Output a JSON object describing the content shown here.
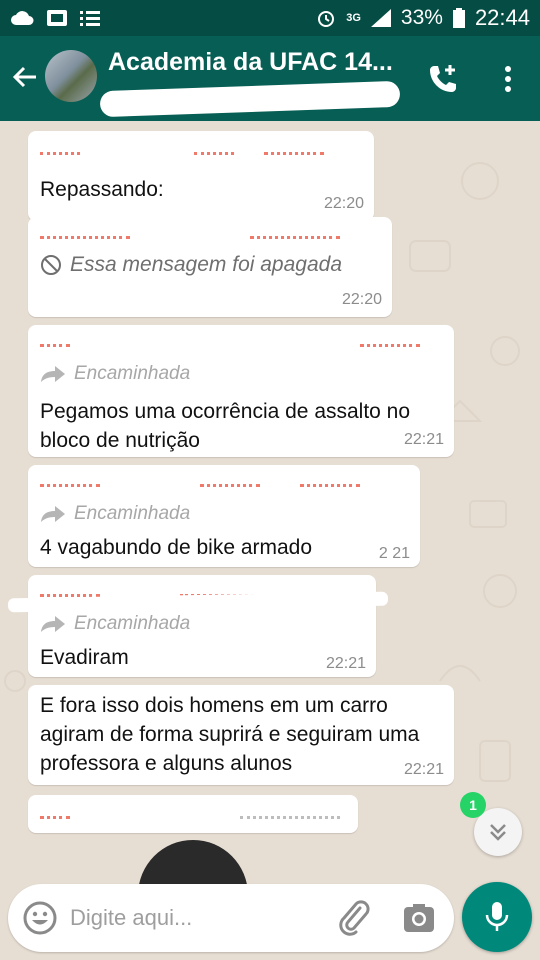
{
  "status_bar": {
    "network": "3G",
    "battery_percent": "33%",
    "time": "22:44"
  },
  "header": {
    "title": "Academia da UFAC 14..."
  },
  "messages": [
    {
      "text": "Repassando:",
      "time": "22:20"
    },
    {
      "deleted_text": "Essa mensagem foi apagada",
      "time": "22:20"
    },
    {
      "forwarded_label": "Encaminhada",
      "text": "Pegamos uma ocorrência de assalto no bloco de nutrição",
      "time": "22:21"
    },
    {
      "forwarded_label": "Encaminhada",
      "text": "4 vagabundo de bike armado",
      "time": "2 21"
    },
    {
      "forwarded_label": "Encaminhada",
      "text": "Evadiram",
      "time": "22:21"
    },
    {
      "text": "E fora isso dois homens em um carro agiram de forma suprirá e seguiram uma professora e alguns alunos",
      "time": "22:21"
    }
  ],
  "unread_count": "1",
  "input": {
    "placeholder": "Digite aqui..."
  },
  "colors": {
    "header": "#075e54",
    "status_bar": "#054d44",
    "mic_button": "#00897b",
    "unread_badge": "#25d366",
    "sender_name": "#f07a6a"
  }
}
